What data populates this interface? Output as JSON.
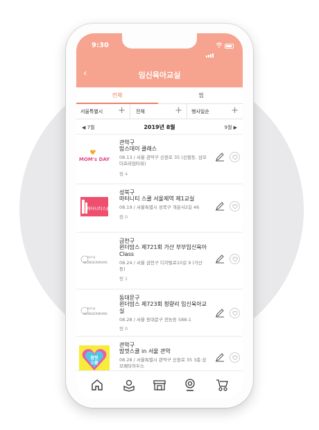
{
  "status_bar": {
    "time": "9:30"
  },
  "header": {
    "title": "임신육아교실",
    "back_icon": "chevron-left-icon"
  },
  "tabs": [
    {
      "label": "전체",
      "active": true
    },
    {
      "label": "찜",
      "active": false
    }
  ],
  "filters": [
    {
      "label": "서울특별시"
    },
    {
      "label": "전체"
    },
    {
      "label": "행사일순"
    }
  ],
  "month_nav": {
    "prev": "◀ 7월",
    "current": "2019년 8월",
    "next": "9월 ▶"
  },
  "classes": [
    {
      "district": "관악구",
      "name": "맘스데이 클래스",
      "info": "08.13 / 서울 관악구 신원로 35 (신림동, 삼모더프라임타워)",
      "favorites": "찜 4",
      "thumb_text": "MOM's DAY"
    },
    {
      "district": "성북구",
      "name": "마터니티 스쿨 서울제역 제1교실",
      "info": "08.19 / 서울특별시 성북구 개운사2길 46",
      "favorites": "찜 0",
      "thumb_text": "마터니티스쿨"
    },
    {
      "district": "금천구",
      "name": "윈더맘스 제721회 가산 부부임신육아 Class",
      "info": "08.24 / 서울 금천구 디지털로10길 9 (가산동)",
      "favorites": "찜 1",
      "thumb_text": "WONDERMOMS"
    },
    {
      "district": "동대문구",
      "name": "윈더맘스 제723회 청량리 임신육아교실",
      "info": "08.28 / 서울 동대문구 전농동 588-1",
      "favorites": "찜 0",
      "thumb_text": "WONDERMOMS"
    },
    {
      "district": "관악구",
      "name": "맘껏스쿨 in 서울 관악",
      "info": "08.28 / 서울특별시 관악구 신원로 35 3층 삼모페타하우스",
      "favorites": "찜 0",
      "thumb_text": "맘껏스쿨"
    }
  ],
  "bottom_nav": [
    {
      "icon": "home-icon"
    },
    {
      "icon": "book-icon"
    },
    {
      "icon": "store-icon"
    },
    {
      "icon": "webcam-icon"
    },
    {
      "icon": "stroller-icon"
    }
  ],
  "colors": {
    "accent": "#f6a38f",
    "tab_active": "#e8806a"
  }
}
